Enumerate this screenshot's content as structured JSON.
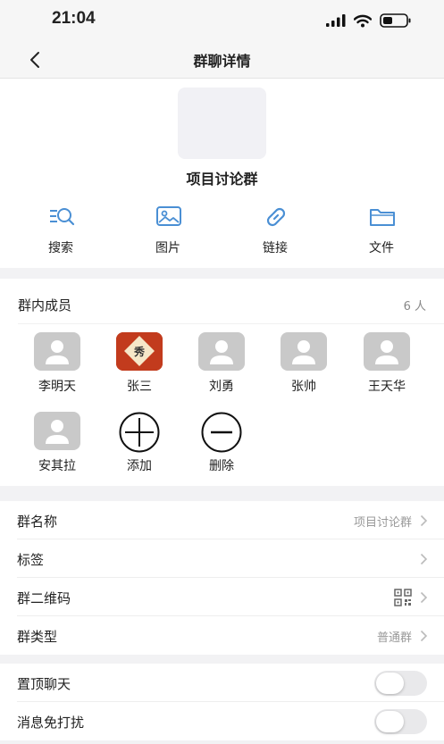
{
  "status_bar": {
    "time": "21:04"
  },
  "nav": {
    "title": "群聊详情"
  },
  "group": {
    "name": "项目讨论群"
  },
  "actions": [
    {
      "label": "搜索",
      "icon": "search-icon"
    },
    {
      "label": "图片",
      "icon": "image-icon"
    },
    {
      "label": "链接",
      "icon": "link-icon"
    },
    {
      "label": "文件",
      "icon": "folder-icon"
    }
  ],
  "members": {
    "title": "群内成员",
    "count": "6 人",
    "list": [
      {
        "name": "李明天"
      },
      {
        "name": "张三"
      },
      {
        "name": "刘勇"
      },
      {
        "name": "张帅"
      },
      {
        "name": "王天华"
      },
      {
        "name": "安其拉"
      }
    ],
    "add_label": "添加",
    "remove_label": "删除"
  },
  "settings": {
    "group_name_label": "群名称",
    "group_name_value": "项目讨论群",
    "tags_label": "标签",
    "qrcode_label": "群二维码",
    "type_label": "群类型",
    "type_value": "普通群"
  },
  "toggles": {
    "pin_label": "置顶聊天",
    "pin_on": false,
    "mute_label": "消息免打扰",
    "mute_on": false
  },
  "colors": {
    "accent": "#4a8fd4",
    "avatar_photo": "#c23b1d"
  }
}
